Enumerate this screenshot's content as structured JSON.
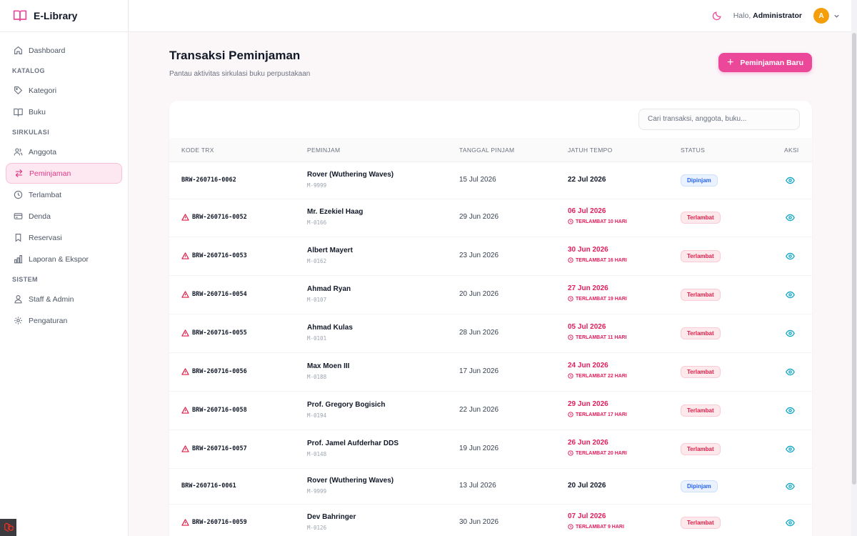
{
  "app": {
    "name": "E-Library"
  },
  "sidebar": {
    "dashboard": "Dashboard",
    "sections": {
      "katalog": "KATALOG",
      "sirkulasi": "SIRKULASI",
      "sistem": "SISTEM"
    },
    "items": {
      "kategori": "Kategori",
      "buku": "Buku",
      "anggota": "Anggota",
      "peminjaman": "Peminjaman",
      "terlambat": "Terlambat",
      "denda": "Denda",
      "reservasi": "Reservasi",
      "laporan": "Laporan & Ekspor",
      "staff": "Staff & Admin",
      "pengaturan": "Pengaturan"
    }
  },
  "topbar": {
    "greeting_prefix": "Halo,",
    "user": "Administrator",
    "avatar_initial": "A"
  },
  "page": {
    "title": "Transaksi Peminjaman",
    "subtitle": "Pantau aktivitas sirkulasi buku perpustakaan",
    "new_button": "Peminjaman Baru"
  },
  "search": {
    "placeholder": "Cari transaksi, anggota, buku..."
  },
  "table": {
    "headers": [
      "KODE TRX",
      "PEMINJAM",
      "TANGGAL PINJAM",
      "JATUH TEMPO",
      "STATUS",
      "AKSI"
    ],
    "rows": [
      {
        "code": "BRW-260716-0062",
        "name": "Rover (Wuthering Waves)",
        "member": "M-9999",
        "borrowed": "15 Jul 2026",
        "due": "22 Jul 2026",
        "late_note": "",
        "status": "Dipinjam",
        "overdue": false
      },
      {
        "code": "BRW-260716-0052",
        "name": "Mr. Ezekiel Haag",
        "member": "M-0166",
        "borrowed": "29 Jun 2026",
        "due": "06 Jul 2026",
        "late_note": "TERLAMBAT 10 HARI",
        "status": "Terlambat",
        "overdue": true
      },
      {
        "code": "BRW-260716-0053",
        "name": "Albert Mayert",
        "member": "M-0162",
        "borrowed": "23 Jun 2026",
        "due": "30 Jun 2026",
        "late_note": "TERLAMBAT 16 HARI",
        "status": "Terlambat",
        "overdue": true
      },
      {
        "code": "BRW-260716-0054",
        "name": "Ahmad Ryan",
        "member": "M-0107",
        "borrowed": "20 Jun 2026",
        "due": "27 Jun 2026",
        "late_note": "TERLAMBAT 19 HARI",
        "status": "Terlambat",
        "overdue": true
      },
      {
        "code": "BRW-260716-0055",
        "name": "Ahmad Kulas",
        "member": "M-0101",
        "borrowed": "28 Jun 2026",
        "due": "05 Jul 2026",
        "late_note": "TERLAMBAT 11 HARI",
        "status": "Terlambat",
        "overdue": true
      },
      {
        "code": "BRW-260716-0056",
        "name": "Max Moen III",
        "member": "M-0188",
        "borrowed": "17 Jun 2026",
        "due": "24 Jun 2026",
        "late_note": "TERLAMBAT 22 HARI",
        "status": "Terlambat",
        "overdue": true
      },
      {
        "code": "BRW-260716-0058",
        "name": "Prof. Gregory Bogisich",
        "member": "M-0194",
        "borrowed": "22 Jun 2026",
        "due": "29 Jun 2026",
        "late_note": "TERLAMBAT 17 HARI",
        "status": "Terlambat",
        "overdue": true
      },
      {
        "code": "BRW-260716-0057",
        "name": "Prof. Jamel Aufderhar DDS",
        "member": "M-0148",
        "borrowed": "19 Jun 2026",
        "due": "26 Jun 2026",
        "late_note": "TERLAMBAT 20 HARI",
        "status": "Terlambat",
        "overdue": true
      },
      {
        "code": "BRW-260716-0061",
        "name": "Rover (Wuthering Waves)",
        "member": "M-9999",
        "borrowed": "13 Jul 2026",
        "due": "20 Jul 2026",
        "late_note": "",
        "status": "Dipinjam",
        "overdue": false
      },
      {
        "code": "BRW-260716-0059",
        "name": "Dev Bahringer",
        "member": "M-0126",
        "borrowed": "30 Jun 2026",
        "due": "07 Jul 2026",
        "late_note": "TERLAMBAT 9 HARI",
        "status": "Terlambat",
        "overdue": true
      }
    ]
  },
  "colors": {
    "accent": "#ec4899",
    "danger": "#e11d5b",
    "info": "#2563eb",
    "eye": "#0ea5c6"
  }
}
